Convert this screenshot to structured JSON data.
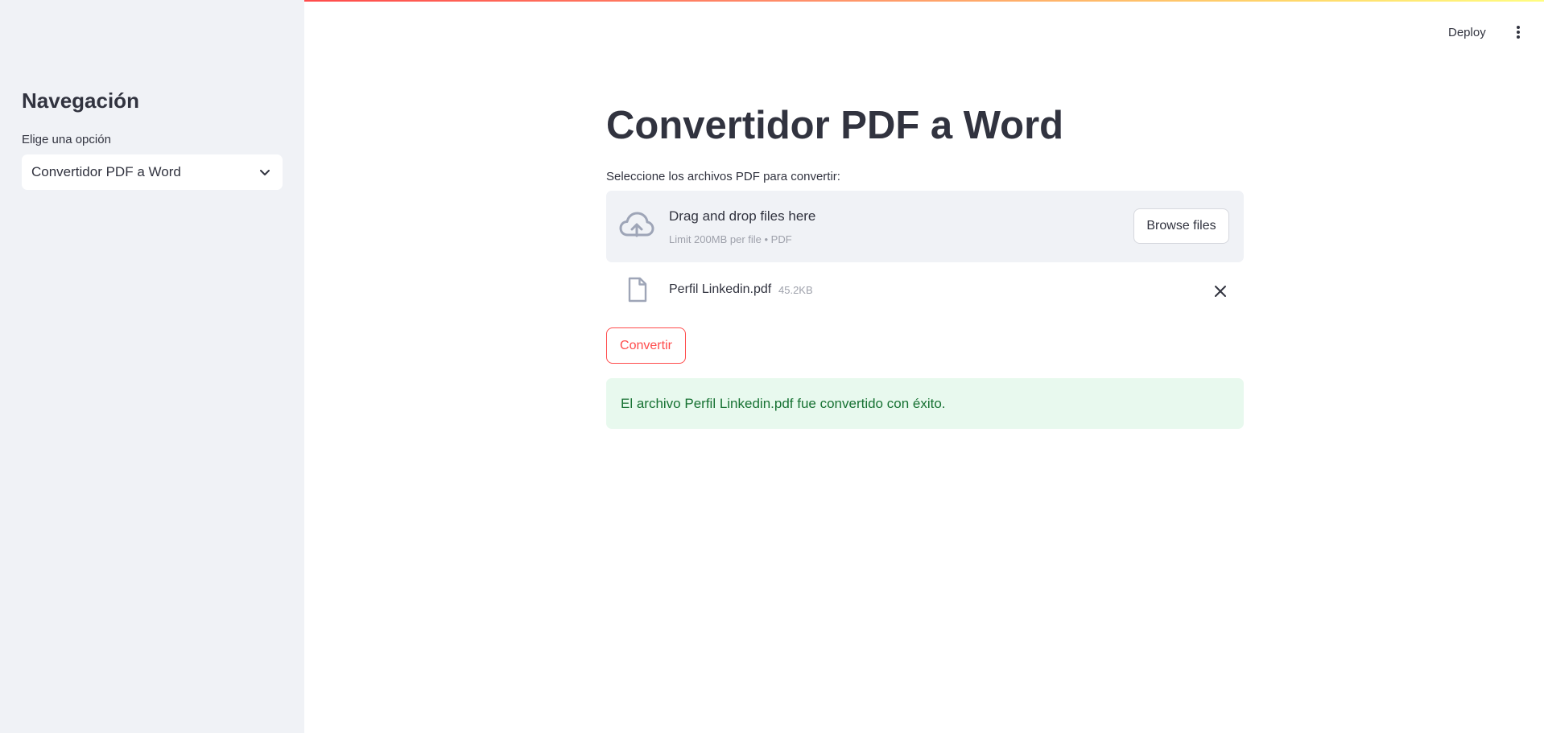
{
  "sidebar": {
    "title": "Navegación",
    "select_label": "Elige una opción",
    "select_value": "Convertidor PDF a Word",
    "icons": {
      "select_chevron": "chevron-down-icon"
    }
  },
  "header": {
    "deploy_label": "Deploy",
    "menu_icon": "kebab-menu-icon"
  },
  "main": {
    "title": "Convertidor PDF a Word",
    "uploader": {
      "label": "Seleccione los archivos PDF para convertir:",
      "dropzone_title": "Drag and drop files here",
      "dropzone_limit": "Limit 200MB per file • PDF",
      "browse_label": "Browse files",
      "icon": "cloud-upload-icon"
    },
    "files": [
      {
        "name": "Perfil Linkedin.pdf",
        "size": "45.2KB",
        "icon": "file-icon",
        "remove_icon": "close-icon"
      }
    ],
    "convert_label": "Convertir",
    "success_message": "El archivo Perfil Linkedin.pdf fue convertido con éxito."
  },
  "colors": {
    "sidebar_bg": "#f0f2f6",
    "text": "#31333f",
    "accent": "#ff4b4b",
    "muted": "#9ea1ab",
    "success_bg": "#e8f9ee",
    "success_text": "#177233"
  }
}
